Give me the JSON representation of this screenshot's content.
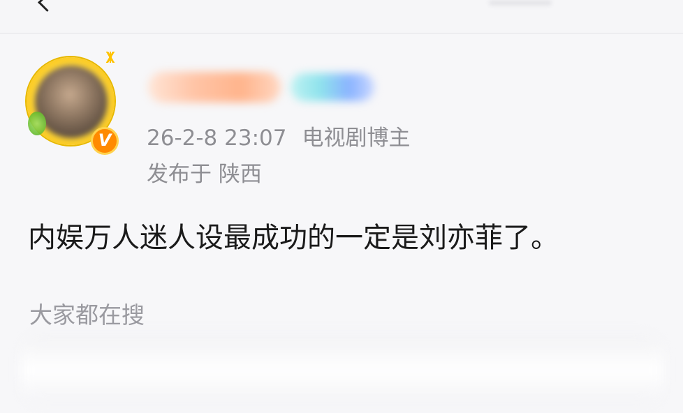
{
  "post": {
    "published_time": "26-2-8 23:07",
    "author_tag": "电视剧博主",
    "location": "发布于 陕西",
    "text": "内娱万人迷人设最成功的一定是刘亦菲了。",
    "verified_badge": "V"
  },
  "search_section": {
    "title": "大家都在搜"
  },
  "colors": {
    "meta_gray": "#8e8e93",
    "text_dark": "#1a1a1a",
    "badge_orange": "#ff8a00",
    "avatar_frame_yellow": "#ffd83a"
  },
  "icons": {
    "back": "chevron-left-icon",
    "verified": "verified-v-icon"
  }
}
